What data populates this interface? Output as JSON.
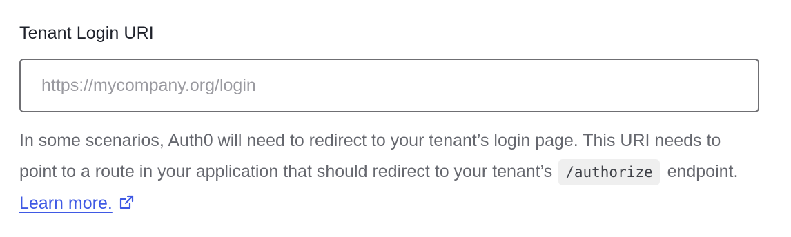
{
  "field": {
    "label": "Tenant Login URI",
    "placeholder": "https://mycompany.org/login",
    "value": ""
  },
  "help": {
    "text_before": "In some scenarios, Auth0 will need to redirect to your tenant’s login page. This URI needs to point to a route in your application that should redirect to your tenant’s ",
    "code": "/authorize",
    "text_after": " endpoint. ",
    "link_label": "Learn more.",
    "link_icon": "external-link-icon"
  },
  "colors": {
    "link": "#3f59e4",
    "help_text": "#65676e",
    "label": "#1e212a",
    "input_border": "#6f6f73"
  }
}
